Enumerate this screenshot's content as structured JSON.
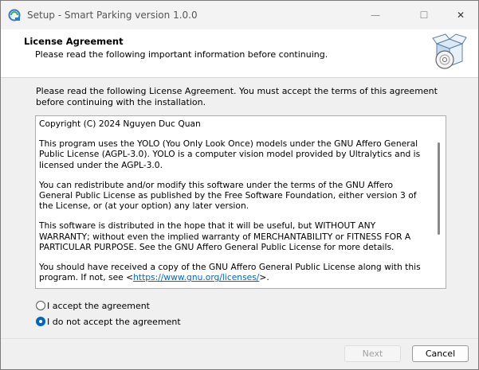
{
  "window": {
    "title": "Setup - Smart Parking version 1.0.0",
    "controls": {
      "minimize": "—",
      "maximize": "☐",
      "close": "✕"
    }
  },
  "header": {
    "title": "License Agreement",
    "subtitle": "Please read the following important information before continuing."
  },
  "intro_text": "Please read the following License Agreement. You must accept the terms of this agreement before continuing with the installation.",
  "license": {
    "paragraphs": [
      "Copyright (C) 2024 Nguyen Duc Quan",
      "This program uses the YOLO (You Only Look Once) models under the GNU Affero General Public License (AGPL-3.0). YOLO is a computer vision model provided by Ultralytics and is licensed under the AGPL-3.0.",
      "You can redistribute and/or modify this software under the terms of the GNU Affero General Public License as published by the Free Software Foundation, either version 3 of the License, or (at your option) any later version.",
      "This software is distributed in the hope that it will be useful, but WITHOUT ANY WARRANTY; without even the implied warranty of MERCHANTABILITY or FITNESS FOR A PARTICULAR PURPOSE. See the GNU Affero General Public License for more details."
    ],
    "last_paragraph_prefix": "You should have received a copy of the GNU Affero General Public License along with this program. If not, see <",
    "link_text": "https://www.gnu.org/licenses/",
    "last_paragraph_suffix": ">."
  },
  "options": {
    "accept_label": "I accept the agreement",
    "decline_label": "I do not accept the agreement",
    "selected": "decline"
  },
  "buttons": {
    "next": "Next",
    "cancel": "Cancel"
  },
  "icons": {
    "app": "setup-app-icon",
    "header": "box-with-disc-icon",
    "scroll_thumb": "scrollbar-thumb"
  },
  "colors": {
    "accent": "#0067c0",
    "link": "#0066cc"
  }
}
